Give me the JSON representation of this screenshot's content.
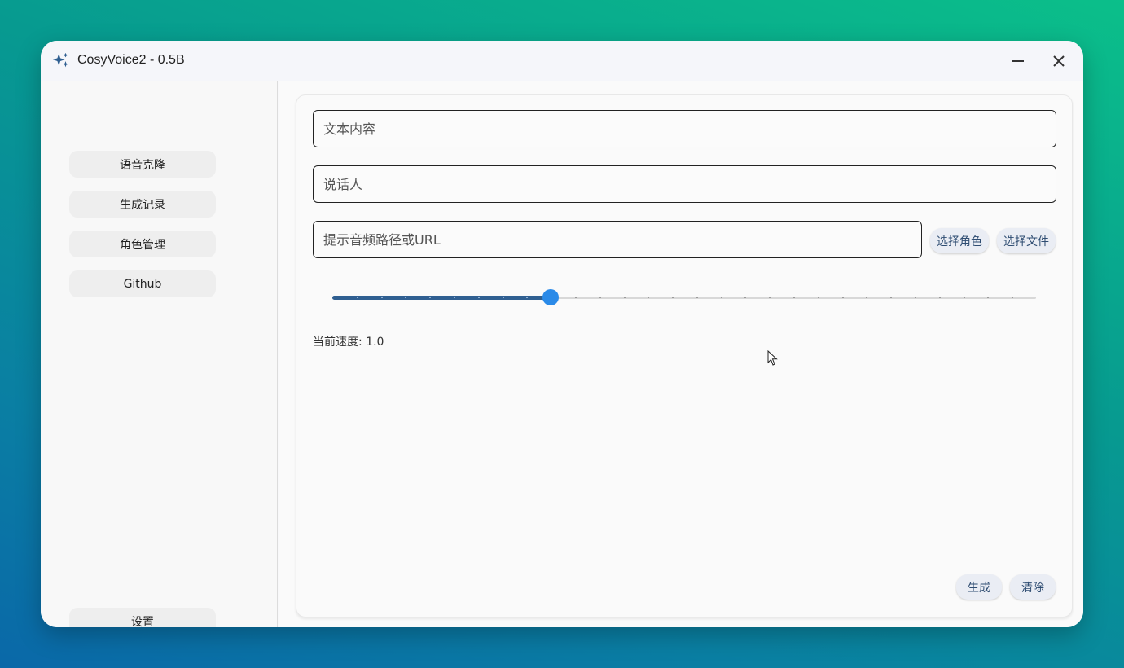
{
  "window": {
    "title": "CosyVoice2 - 0.5B",
    "icon": "sparkle-icon",
    "accent": "#2f5f91"
  },
  "sidebar": {
    "items": [
      {
        "label": "语音克隆"
      },
      {
        "label": "生成记录"
      },
      {
        "label": "角色管理"
      },
      {
        "label": "Github"
      }
    ],
    "settings_label": "设置"
  },
  "form": {
    "text_placeholder": "文本内容",
    "speaker_placeholder": "说话人",
    "prompt_placeholder": "提示音频路径或URL",
    "select_role_label": "选择角色",
    "select_file_label": "选择文件",
    "speed": {
      "value_fraction": 0.31,
      "label": "当前速度: 1.0"
    },
    "generate_label": "生成",
    "clear_label": "清除"
  }
}
